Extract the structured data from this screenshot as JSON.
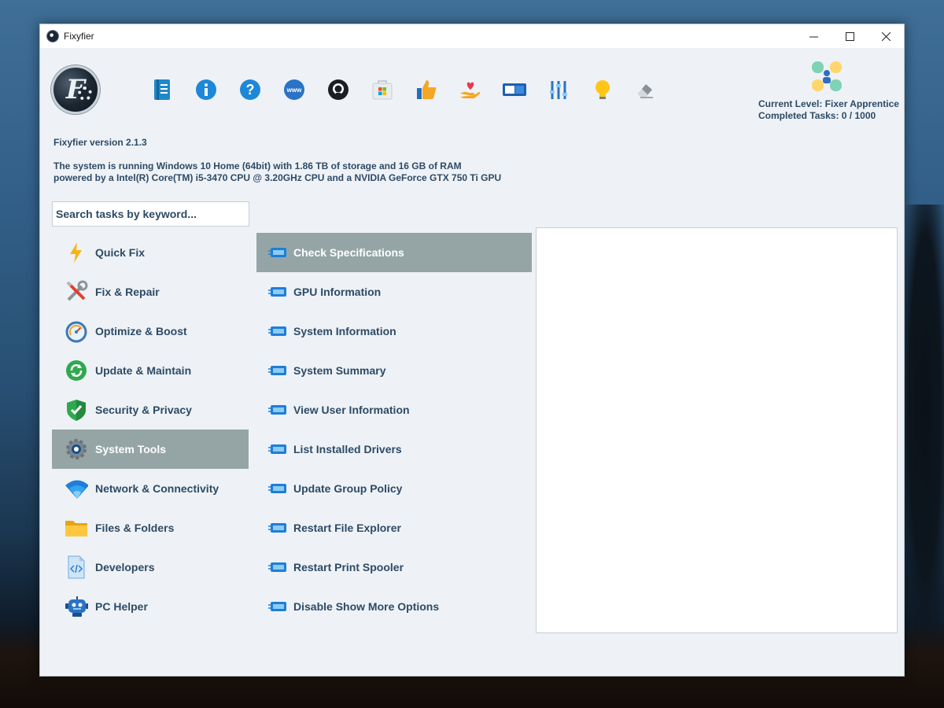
{
  "window": {
    "title": "Fixyfier"
  },
  "toolbar": {
    "icons": [
      "notes-icon",
      "info-icon",
      "help-icon",
      "website-icon",
      "github-icon",
      "microsoft-store-icon",
      "thumbs-up-icon",
      "donate-heart-icon",
      "toggle-theme-icon",
      "settings-sliders-icon",
      "lightbulb-icon",
      "eraser-icon"
    ]
  },
  "level": {
    "current": "Current Level: Fixer Apprentice",
    "completed": "Completed Tasks: 0 / 1000"
  },
  "header": {
    "version": "Fixyfier version 2.1.3",
    "sysinfo_line1": "The system is running Windows 10 Home (64bit) with 1.86 TB of storage and 16 GB of RAM",
    "sysinfo_line2": "powered by a Intel(R) Core(TM) i5-3470 CPU @ 3.20GHz CPU and a NVIDIA GeForce GTX 750 Ti GPU"
  },
  "search": {
    "placeholder": "Search tasks by keyword..."
  },
  "categories": [
    {
      "label": "Quick Fix",
      "icon": "lightning-icon"
    },
    {
      "label": "Fix & Repair",
      "icon": "tools-icon"
    },
    {
      "label": "Optimize & Boost",
      "icon": "speedometer-icon"
    },
    {
      "label": "Update & Maintain",
      "icon": "refresh-icon"
    },
    {
      "label": "Security & Privacy",
      "icon": "shield-check-icon"
    },
    {
      "label": "System Tools",
      "icon": "gear-icon",
      "selected": true
    },
    {
      "label": "Network & Connectivity",
      "icon": "wifi-icon"
    },
    {
      "label": "Files & Folders",
      "icon": "folder-icon"
    },
    {
      "label": "Developers",
      "icon": "code-file-icon"
    },
    {
      "label": "PC Helper",
      "icon": "robot-icon"
    }
  ],
  "tasks": [
    {
      "label": "Check Specifications",
      "selected": true
    },
    {
      "label": "GPU Information"
    },
    {
      "label": "System Information"
    },
    {
      "label": "System Summary"
    },
    {
      "label": "View User Information"
    },
    {
      "label": "List Installed Drivers"
    },
    {
      "label": "Update Group Policy"
    },
    {
      "label": "Restart File Explorer"
    },
    {
      "label": "Restart Print Spooler"
    },
    {
      "label": "Disable Show More Options"
    }
  ],
  "colors": {
    "accent_selected": "#95a5a6",
    "text": "#2d4a66",
    "window_bg": "#eef2f6"
  }
}
